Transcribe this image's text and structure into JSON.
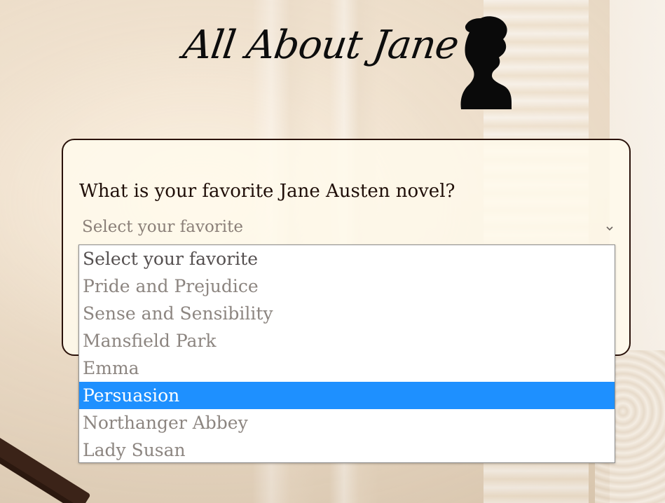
{
  "header": {
    "title": "All About Jane",
    "silhouette_icon": "woman-profile-silhouette-icon"
  },
  "form": {
    "question": "What is your favorite Jane Austen novel?",
    "select": {
      "value": "Select your favorite",
      "chevron_icon": "chevron-down-icon"
    },
    "options": [
      "Select your favorite",
      "Pride and Prejudice",
      "Sense and Sensibility",
      "Mansfield Park",
      "Emma",
      "Persuasion",
      "Northanger Abbey",
      "Lady Susan"
    ],
    "highlighted_option": "Persuasion"
  },
  "colors": {
    "highlight": "#1e90ff",
    "card_border": "#2a120a",
    "text_dark": "#1f0e08"
  }
}
